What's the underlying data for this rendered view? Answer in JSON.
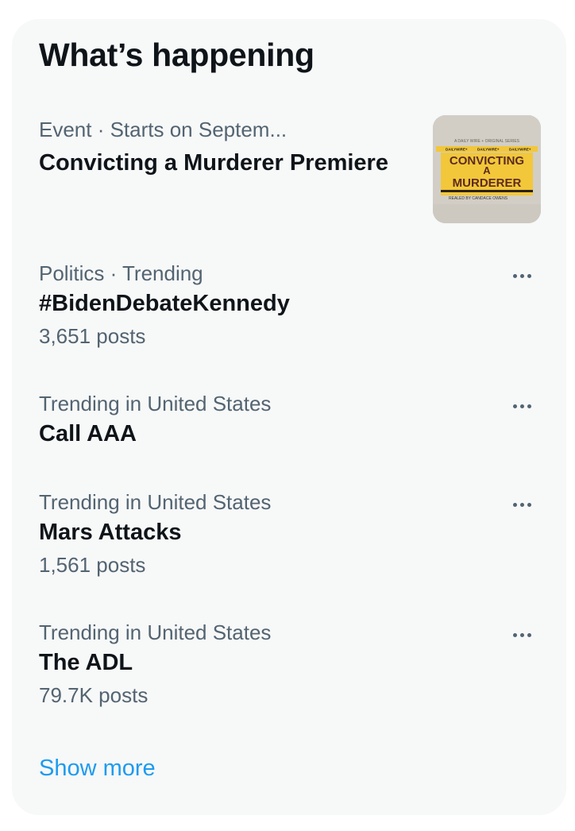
{
  "widget": {
    "title": "What’s happening",
    "show_more": "Show more"
  },
  "event": {
    "meta": "Event · Starts on Septem...",
    "name": "Convicting a Murderer Premiere",
    "thumbnail": {
      "series_line": "A DAILY WIRE + ORIGINAL SERIES",
      "tape_label": "DAILYWIRE+",
      "title_line1": "CONVICTING",
      "title_line2": "A",
      "title_line3": "MURDERER",
      "byline": "REALED BY CANDACE OWENS"
    }
  },
  "trends": [
    {
      "meta": "Politics · Trending",
      "name": "#BidenDebateKennedy",
      "count": "3,651 posts"
    },
    {
      "meta": "Trending in United States",
      "name": "Call AAA",
      "count": ""
    },
    {
      "meta": "Trending in United States",
      "name": "Mars Attacks",
      "count": "1,561 posts"
    },
    {
      "meta": "Trending in United States",
      "name": "The ADL",
      "count": "79.7K posts"
    }
  ],
  "colors": {
    "accent": "#1d9bf0",
    "secondary_text": "#536471",
    "card_background": "#f7f8f8",
    "tape_yellow": "#f2c73a"
  }
}
